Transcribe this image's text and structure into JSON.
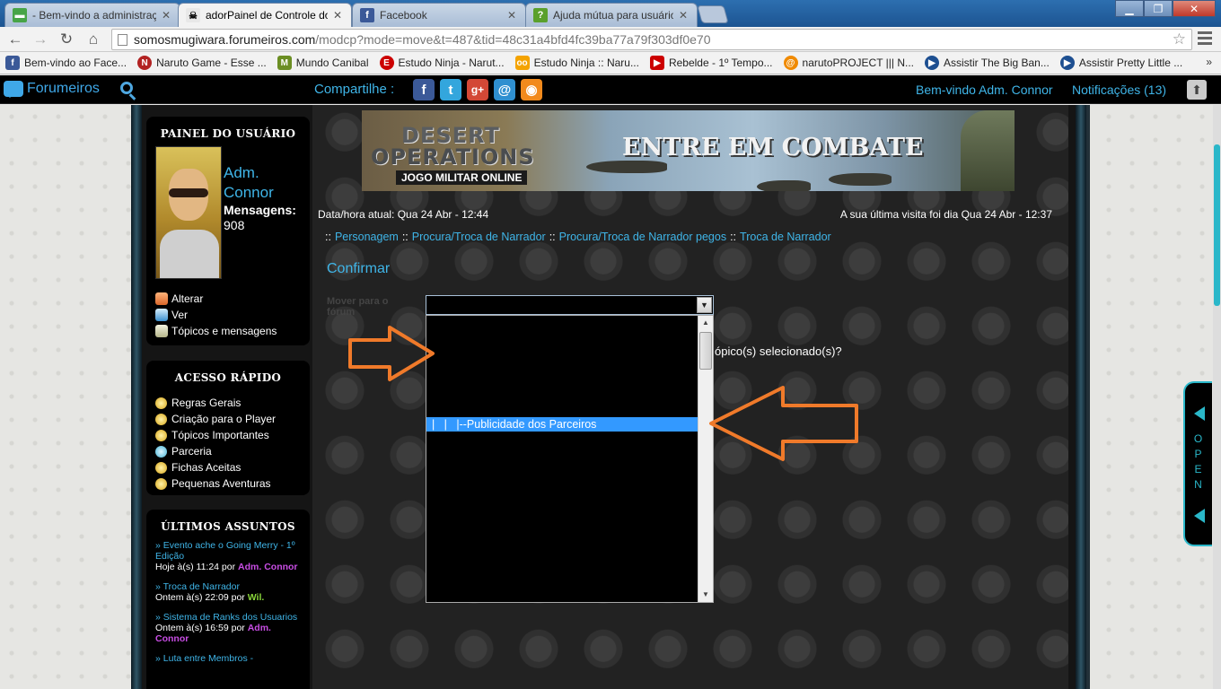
{
  "browser": {
    "tabs": [
      {
        "label": "- Bem-vindo a administraç",
        "active": false,
        "icon": "forum-icon",
        "color": "#47a447"
      },
      {
        "label": "adorPainel de Controle do",
        "active": true,
        "icon": "skull-icon",
        "color": "#222222"
      },
      {
        "label": "Facebook",
        "active": false,
        "icon": "facebook-icon",
        "color": "#3b5998"
      },
      {
        "label": "Ajuda mútua para usuário",
        "active": false,
        "icon": "help-icon",
        "color": "#5aa02c"
      }
    ],
    "url_domain": "somosmugiwara.forumeiros.com",
    "url_path": "/modcp?mode=move&t=487&tid=48c31a4bfd4fc39ba77a79f303df0e70",
    "bookmarks": [
      {
        "label": "Bem-vindo ao Face...",
        "icon": "facebook-icon",
        "color": "#3b5998",
        "glyph": "f"
      },
      {
        "label": "Naruto Game - Esse ...",
        "icon": "naruto-icon",
        "color": "#b22222",
        "glyph": "N"
      },
      {
        "label": "Mundo Canibal",
        "icon": "canibal-icon",
        "color": "#6b8e23",
        "glyph": "M"
      },
      {
        "label": "Estudo Ninja - Narut...",
        "icon": "ninja-icon",
        "color": "#cc0000",
        "glyph": "E"
      },
      {
        "label": "Estudo Ninja :: Naru...",
        "icon": "ninja-eyes-icon",
        "color": "#f4a300",
        "glyph": "oo"
      },
      {
        "label": "Rebelde - 1º Tempo...",
        "icon": "youtube-icon",
        "color": "#cc0000",
        "glyph": "▶"
      },
      {
        "label": "narutoPROJECT ||| N...",
        "icon": "narutoproject-icon",
        "color": "#f08a00",
        "glyph": "@"
      },
      {
        "label": "Assistir The Big Ban...",
        "icon": "play-icon",
        "color": "#1d4f91",
        "glyph": "▶"
      },
      {
        "label": "Assistir Pretty Little ...",
        "icon": "play-icon",
        "color": "#1d4f91",
        "glyph": "▶"
      }
    ],
    "bookmarks_more": "»"
  },
  "forumbar": {
    "logo": "Forumeiros",
    "share_label": "Compartilhe :",
    "social": [
      {
        "name": "facebook-share-icon",
        "glyph": "f",
        "color": "#3b5998"
      },
      {
        "name": "twitter-share-icon",
        "glyph": "t",
        "color": "#33a6dd"
      },
      {
        "name": "googleplus-share-icon",
        "glyph": "g+",
        "color": "#d34836"
      },
      {
        "name": "email-share-icon",
        "glyph": "@",
        "color": "#2f8fd0"
      },
      {
        "name": "rss-share-icon",
        "glyph": "◉",
        "color": "#f28a1c"
      }
    ],
    "welcome": "Bem-vindo Adm. Connor",
    "notifications": "Notificações  (13)"
  },
  "user_panel": {
    "title": "PAINEL DO USUÁRIO",
    "username_line1": "Adm.",
    "username_line2": "Connor",
    "messages_label": "Mensagens:",
    "messages_count": "908",
    "links": [
      "Alterar",
      "Ver",
      "Tópicos e mensagens"
    ]
  },
  "quick_access": {
    "title": "ACESSO RÁPIDO",
    "links": [
      "Regras Gerais",
      "Criação para o Player",
      "Tópicos Importantes",
      "Parceria",
      "Fichas Aceitas",
      "Pequenas Aventuras"
    ]
  },
  "latest_topics": {
    "title": "ÚLTIMOS ASSUNTOS",
    "items": [
      {
        "title": "Evento ache o Going Merry - 1º Edição",
        "when": "Hoje à(s) 11:24 por",
        "by": "Adm. Connor"
      },
      {
        "title": "Troca de Narrador",
        "when": "Ontem à(s) 22:09 por",
        "by": "Wil."
      },
      {
        "title": "Sistema de Ranks dos Usuarios",
        "when": "Ontem à(s) 16:59 por",
        "by": "Adm. Connor"
      },
      {
        "title": "Luta entre Membros -",
        "when": "",
        "by": ""
      }
    ]
  },
  "banner": {
    "logo_line1": "DESERT",
    "logo_line2": "OPERATIONS",
    "tagline": "JOGO MILITAR ONLINE",
    "headline": "ENTRE EM COMBATE"
  },
  "main": {
    "datetime": "Data/hora atual: Qua 24 Abr - 12:44",
    "last_visit": "A sua última visita foi dia Qua 24 Abr - 12:37",
    "breadcrumb_sep": "::",
    "breadcrumbs": [
      "Personagem",
      "Procura/Troca de Narrador",
      "Procura/Troca de Narrador pegos",
      "Troca de Narrador"
    ],
    "confirm_title": "Confirmar",
    "move_label": "Mover para o fórum",
    "question": "ópico(s) selecionado(s)?",
    "dropdown_selected": "|   |   |--Publicidade dos Parceiros"
  },
  "open_widget": {
    "label": "OPEN"
  },
  "colors": {
    "accent": "#3fb5e8",
    "highlight": "#3399ff",
    "cyan_border": "#2ab7c9",
    "arrow": "#f07a2a",
    "admin": "#c84de4",
    "member": "#8ad63a"
  }
}
